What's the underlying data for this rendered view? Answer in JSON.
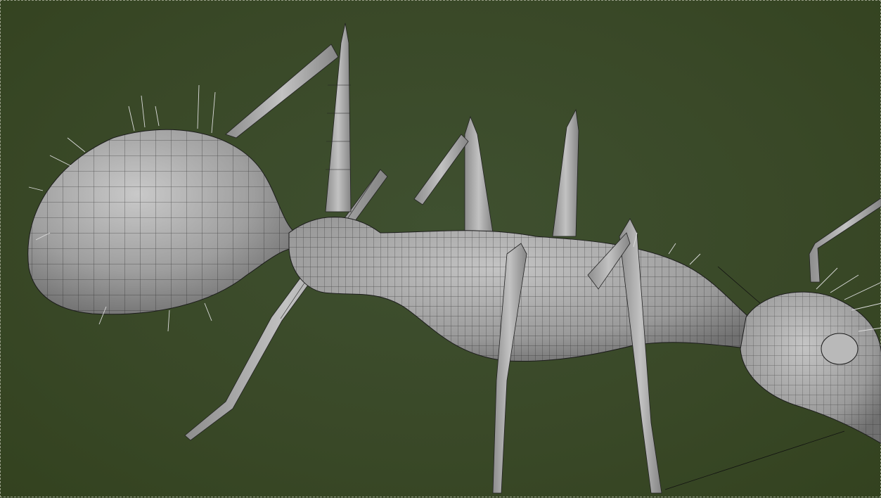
{
  "viewport": {
    "background": "#3b4a2a",
    "mesh_fill": "#a9a9a9",
    "mesh_wire": "#222222",
    "model": "ant"
  }
}
